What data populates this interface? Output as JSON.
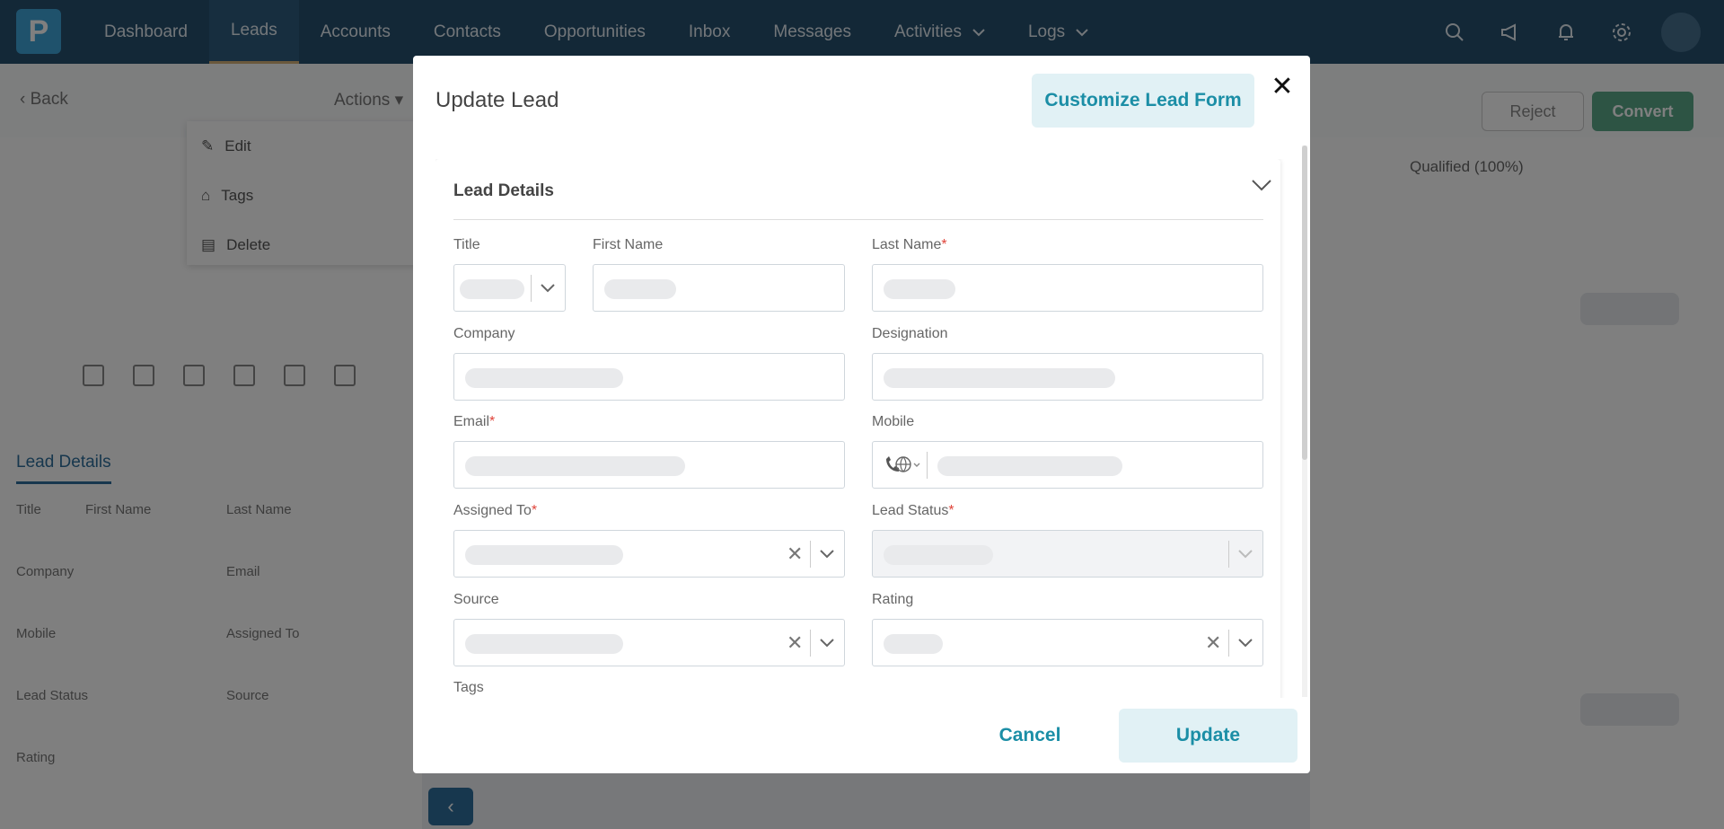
{
  "app": {
    "logo_letter": "P",
    "nav": {
      "items": [
        {
          "label": "Dashboard"
        },
        {
          "label": "Leads"
        },
        {
          "label": "Accounts"
        },
        {
          "label": "Contacts"
        },
        {
          "label": "Opportunities"
        },
        {
          "label": "Inbox"
        },
        {
          "label": "Messages"
        },
        {
          "label": "Activities"
        },
        {
          "label": "Logs"
        }
      ],
      "active": "Leads",
      "icons": [
        "search-icon",
        "megaphone-icon",
        "bell-icon",
        "gear-icon"
      ]
    },
    "subbar": {
      "back_label": "Back",
      "actions_label": "Actions",
      "reject_label": "Reject",
      "convert_label": "Convert"
    },
    "actions_menu": {
      "items": [
        {
          "label": "Edit",
          "icon": "pencil-icon"
        },
        {
          "label": "Tags",
          "icon": "tag-icon"
        },
        {
          "label": "Delete",
          "icon": "trash-icon"
        }
      ]
    },
    "lead_details_panel": {
      "title": "Lead Details",
      "labels": {
        "title": "Title",
        "first_name": "First Name",
        "last_name": "Last Name",
        "company": "Company",
        "email": "Email",
        "mobile": "Mobile",
        "assigned_to": "Assigned To",
        "lead_status": "Lead Status",
        "source": "Source",
        "rating": "Rating"
      }
    },
    "status_pipeline": {
      "current": "Qualified (100%)"
    }
  },
  "modal": {
    "title": "Update Lead",
    "customize_label": "Customize Lead Form",
    "close_symbol": "✕",
    "section_title": "Lead Details",
    "fields": {
      "title": {
        "label": "Title",
        "required": false
      },
      "first_name": {
        "label": "First Name",
        "required": false
      },
      "last_name": {
        "label": "Last Name",
        "required": true
      },
      "company": {
        "label": "Company",
        "required": false
      },
      "designation": {
        "label": "Designation",
        "required": false
      },
      "email": {
        "label": "Email",
        "required": true
      },
      "mobile": {
        "label": "Mobile",
        "required": false
      },
      "assigned_to": {
        "label": "Assigned To",
        "required": true
      },
      "lead_status": {
        "label": "Lead Status",
        "required": true
      },
      "source": {
        "label": "Source",
        "required": false
      },
      "rating": {
        "label": "Rating",
        "required": false
      },
      "tags": {
        "label": "Tags",
        "required": false
      }
    },
    "required_marker": "*",
    "clear_symbol": "✕",
    "cancel_label": "Cancel",
    "update_label": "Update"
  },
  "colors": {
    "nav_bg": "#27506e",
    "accent": "#1b8ea6",
    "accent_bg": "#e1f1f5",
    "required": "#e0443a",
    "convert": "#5aa889"
  }
}
